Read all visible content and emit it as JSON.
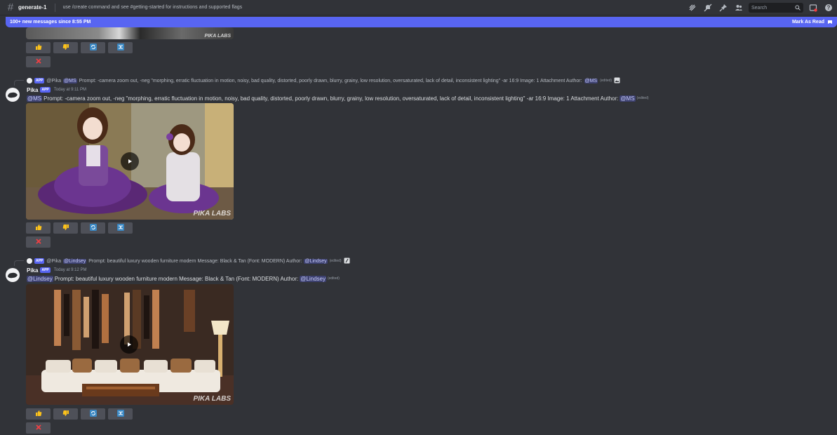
{
  "header": {
    "channel": "generate-1",
    "topic": "use /create command and see #getting-started for instructions and supported flags",
    "search_placeholder": "Search",
    "icons": [
      "threads-icon",
      "notification-mute-icon",
      "pin-icon",
      "members-icon",
      "search-icon",
      "inbox-icon",
      "help-icon"
    ]
  },
  "banner": {
    "text": "100+ new messages since 8:55 PM",
    "mark_read": "Mark As Read"
  },
  "buttons": {
    "icons": [
      "thumbs-up-icon",
      "thumbs-down-icon",
      "refresh-icon",
      "shuffle-icon",
      "delete-x-icon"
    ]
  },
  "messages": [
    {
      "reply_author": "@Pika",
      "reply_mention": "@MS",
      "reply_text": "Prompt: -camera zoom out, -neg \"morphing, erratic fluctuation in motion, noisy, bad quality, distorted, poorly drawn, blurry, grainy, low resolution, oversaturated, lack of detail, inconsistent lighting\" -ar 16:9  Image: 1 Attachment  Author:",
      "reply_author_mention": "@MS",
      "reply_edited": "(edited)",
      "author": "Pika",
      "app_tag": "APP",
      "timestamp": "Today at 9:11 PM",
      "mention": "@MS",
      "text": "Prompt: -camera zoom out, -neg \"morphing, erratic fluctuation in motion, noisy, bad quality, distorted, poorly drawn, blurry, grainy, low resolution, oversaturated, lack of detail, inconsistent lighting\" -ar 16:9  Image: 1 Attachment  Author:",
      "author_mention": "@MS",
      "edited": "(edited)",
      "watermark": "PIKA LABS"
    },
    {
      "reply_author": "@Pika",
      "reply_mention": "@Lindsey",
      "reply_text": "Prompt: beautiful luxury wooden furniture modern  Message: Black & Tan (Font: MODERN)  Author:",
      "reply_author_mention": "@Lindsey",
      "reply_edited": "(edited)",
      "author": "Pika",
      "app_tag": "APP",
      "timestamp": "Today at 9:12 PM",
      "mention": "@Lindsey",
      "text": "Prompt: beautiful luxury wooden furniture modern  Message: Black & Tan (Font: MODERN)  Author:",
      "author_mention": "@Lindsey",
      "edited": "(edited)",
      "watermark": "PIKA LABS"
    }
  ],
  "top_partial": {
    "watermark": "PIKA LABS"
  },
  "colors": {
    "background": "#313338",
    "accent": "#5865f2",
    "button": "#4e5058"
  }
}
